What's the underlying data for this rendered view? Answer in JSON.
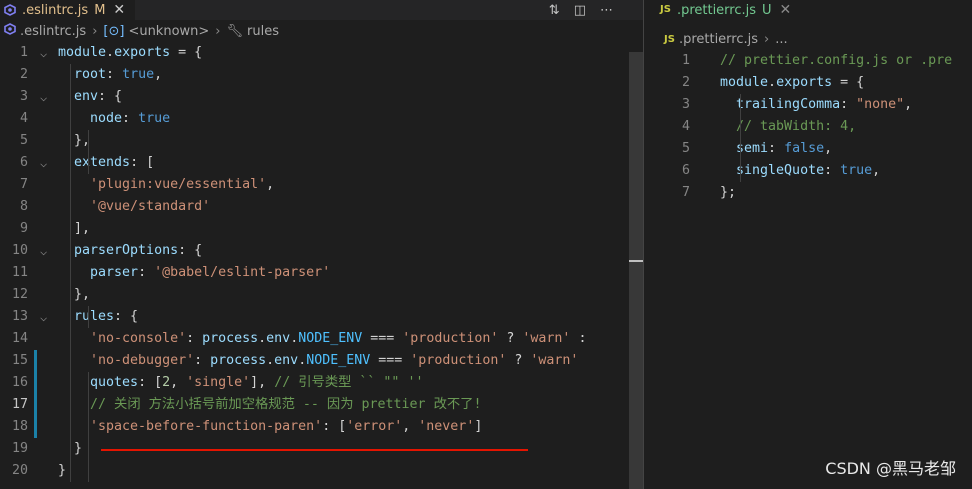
{
  "left": {
    "tab": {
      "label": ".eslintrc.js",
      "status": "M"
    },
    "breadcrumb": [
      ".eslintrc.js",
      "<unknown>",
      "rules"
    ],
    "lines": [
      {
        "n": "1",
        "fold": true,
        "tokens": [
          [
            "m",
            "module"
          ],
          [
            "p",
            "."
          ],
          [
            "m",
            "exports"
          ],
          [
            "p",
            " = {"
          ]
        ]
      },
      {
        "n": "2",
        "tokens": [
          [
            "k",
            "  root"
          ],
          [
            "p",
            ": "
          ],
          [
            "v",
            "true"
          ],
          [
            "p",
            ","
          ]
        ]
      },
      {
        "n": "3",
        "fold": true,
        "tokens": [
          [
            "k",
            "  env"
          ],
          [
            "p",
            ": {"
          ]
        ]
      },
      {
        "n": "4",
        "tokens": [
          [
            "k",
            "    node"
          ],
          [
            "p",
            ": "
          ],
          [
            "v",
            "true"
          ]
        ]
      },
      {
        "n": "5",
        "tokens": [
          [
            "p",
            "  },"
          ]
        ]
      },
      {
        "n": "6",
        "fold": true,
        "tokens": [
          [
            "k",
            "  extends"
          ],
          [
            "p",
            ": ["
          ]
        ]
      },
      {
        "n": "7",
        "tokens": [
          [
            "s",
            "    'plugin:vue/essential'"
          ],
          [
            "p",
            ","
          ]
        ]
      },
      {
        "n": "8",
        "tokens": [
          [
            "s",
            "    '@vue/standard'"
          ]
        ]
      },
      {
        "n": "9",
        "tokens": [
          [
            "p",
            "  ],"
          ]
        ]
      },
      {
        "n": "10",
        "fold": true,
        "tokens": [
          [
            "k",
            "  parserOptions"
          ],
          [
            "p",
            ": {"
          ]
        ]
      },
      {
        "n": "11",
        "tokens": [
          [
            "k",
            "    parser"
          ],
          [
            "p",
            ": "
          ],
          [
            "s",
            "'@babel/eslint-parser'"
          ]
        ]
      },
      {
        "n": "12",
        "tokens": [
          [
            "p",
            "  },"
          ]
        ]
      },
      {
        "n": "13",
        "fold": true,
        "tokens": [
          [
            "k",
            "  rules"
          ],
          [
            "p",
            ": {"
          ]
        ]
      },
      {
        "n": "14",
        "tokens": [
          [
            "s",
            "    'no-console'"
          ],
          [
            "p",
            ": "
          ],
          [
            "m",
            "process"
          ],
          [
            "p",
            "."
          ],
          [
            "m",
            "env"
          ],
          [
            "p",
            "."
          ],
          [
            "cn",
            "NODE_ENV"
          ],
          [
            "p",
            " === "
          ],
          [
            "s",
            "'production'"
          ],
          [
            "p",
            " ? "
          ],
          [
            "s",
            "'warn'"
          ],
          [
            "p",
            " :"
          ]
        ]
      },
      {
        "n": "15",
        "tokens": [
          [
            "s",
            "    'no-debugger'"
          ],
          [
            "p",
            ": "
          ],
          [
            "m",
            "process"
          ],
          [
            "p",
            "."
          ],
          [
            "m",
            "env"
          ],
          [
            "p",
            "."
          ],
          [
            "cn",
            "NODE_ENV"
          ],
          [
            "p",
            " === "
          ],
          [
            "s",
            "'production'"
          ],
          [
            "p",
            " ? "
          ],
          [
            "s",
            "'warn'"
          ]
        ]
      },
      {
        "n": "16",
        "tokens": [
          [
            "k",
            "    quotes"
          ],
          [
            "p",
            ": ["
          ],
          [
            "n",
            "2"
          ],
          [
            "p",
            ", "
          ],
          [
            "s",
            "'single'"
          ],
          [
            "p",
            "], "
          ],
          [
            "c",
            "// 引号类型 `` \"\" ''"
          ]
        ]
      },
      {
        "n": "17",
        "tokens": [
          [
            "c",
            "    // 关闭 方法小括号前加空格规范 -- 因为 prettier 改不了!"
          ]
        ]
      },
      {
        "n": "18",
        "tokens": [
          [
            "s",
            "    'space-before-function-paren'"
          ],
          [
            "p",
            ": ["
          ],
          [
            "s",
            "'error'"
          ],
          [
            "p",
            ", "
          ],
          [
            "s",
            "'never'"
          ],
          [
            "p",
            "]"
          ]
        ]
      },
      {
        "n": "19",
        "tokens": [
          [
            "p",
            "  }"
          ]
        ]
      },
      {
        "n": "20",
        "tokens": [
          [
            "p",
            "}"
          ]
        ]
      }
    ]
  },
  "right": {
    "tab": {
      "label": ".prettierrc.js",
      "status": "U"
    },
    "breadcrumb": [
      ".prettierrc.js",
      "..."
    ],
    "lines": [
      {
        "n": "1",
        "tokens": [
          [
            "c",
            "  // prettier.config.js or .pre"
          ]
        ]
      },
      {
        "n": "2",
        "tokens": [
          [
            "m",
            "  module"
          ],
          [
            "p",
            "."
          ],
          [
            "m",
            "exports"
          ],
          [
            "p",
            " = {"
          ]
        ]
      },
      {
        "n": "3",
        "tokens": [
          [
            "k",
            "    trailingComma"
          ],
          [
            "p",
            ": "
          ],
          [
            "s",
            "\"none\""
          ],
          [
            "p",
            ","
          ]
        ]
      },
      {
        "n": "4",
        "tokens": [
          [
            "c",
            "    // tabWidth: 4,"
          ]
        ]
      },
      {
        "n": "5",
        "tokens": [
          [
            "k",
            "    semi"
          ],
          [
            "p",
            ": "
          ],
          [
            "v",
            "false"
          ],
          [
            "p",
            ","
          ]
        ]
      },
      {
        "n": "6",
        "tokens": [
          [
            "k",
            "    singleQuote"
          ],
          [
            "p",
            ": "
          ],
          [
            "v",
            "true"
          ],
          [
            "p",
            ","
          ]
        ]
      },
      {
        "n": "7",
        "tokens": [
          [
            "p",
            "  };"
          ]
        ]
      }
    ]
  },
  "watermark": "CSDN @黑马老邹"
}
